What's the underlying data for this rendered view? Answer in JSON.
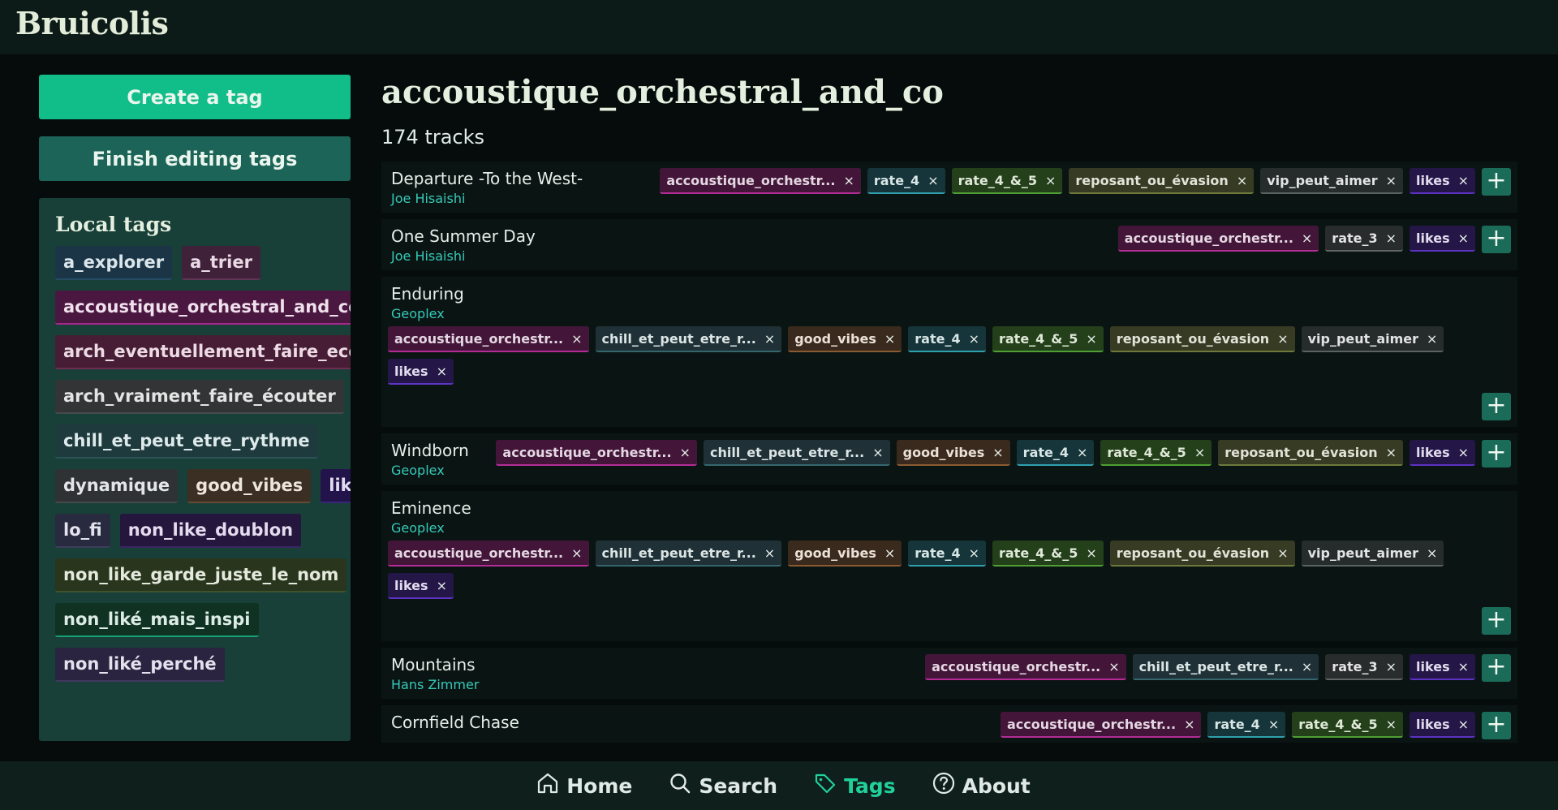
{
  "app": {
    "title": "Bruicolis"
  },
  "sidebar": {
    "create_label": "Create a tag",
    "finish_label": "Finish editing tags",
    "local_title": "Local tags",
    "tags": [
      {
        "label": "a_explorer",
        "theme": "l-explorer"
      },
      {
        "label": "a_trier",
        "theme": "l-trier"
      },
      {
        "label": "accoustique_orchestral_and_co",
        "theme": "l-orch"
      },
      {
        "label": "arch_eventuellement_faire_ecouter",
        "theme": "l-arch1"
      },
      {
        "label": "arch_vraiment_faire_écouter",
        "theme": "l-arch2"
      },
      {
        "label": "chill_et_peut_etre_rythme",
        "theme": "l-chill"
      },
      {
        "label": "dynamique",
        "theme": "l-dyn"
      },
      {
        "label": "good_vibes",
        "theme": "l-good"
      },
      {
        "label": "likes",
        "theme": "l-likes"
      },
      {
        "label": "lo_fi",
        "theme": "l-lofi"
      },
      {
        "label": "non_like_doublon",
        "theme": "l-nonlike"
      },
      {
        "label": "non_like_garde_juste_le_nom",
        "theme": "l-garde"
      },
      {
        "label": "non_liké_mais_inspi",
        "theme": "l-inspi"
      },
      {
        "label": "non_liké_perché",
        "theme": "l-perche"
      }
    ]
  },
  "main": {
    "title": "accoustique_orchestral_and_co",
    "count": "174 tracks",
    "remove_glyph": "×",
    "add_glyph": "+",
    "tracks": [
      {
        "title": "Departure -To the West-",
        "artist": "Joe Hisaishi",
        "wrap": false,
        "tags": [
          {
            "label": "accoustique_orchestr...",
            "theme": "c-orch"
          },
          {
            "label": "rate_4",
            "theme": "c-rate4"
          },
          {
            "label": "rate_4_&_5",
            "theme": "c-rate45"
          },
          {
            "label": "reposant_ou_évasion",
            "theme": "c-repos"
          },
          {
            "label": "vip_peut_aimer",
            "theme": "c-vip"
          },
          {
            "label": "likes",
            "theme": "c-likes"
          }
        ]
      },
      {
        "title": "One Summer Day",
        "artist": "Joe Hisaishi",
        "wrap": false,
        "tags": [
          {
            "label": "accoustique_orchestr...",
            "theme": "c-orch"
          },
          {
            "label": "rate_3",
            "theme": "c-rate3"
          },
          {
            "label": "likes",
            "theme": "c-likes"
          }
        ]
      },
      {
        "title": "Enduring",
        "artist": "Geoplex",
        "wrap": true,
        "tags": [
          {
            "label": "accoustique_orchestr...",
            "theme": "c-orch"
          },
          {
            "label": "chill_et_peut_etre_r...",
            "theme": "c-chill"
          },
          {
            "label": "good_vibes",
            "theme": "c-good"
          },
          {
            "label": "rate_4",
            "theme": "c-rate4"
          },
          {
            "label": "rate_4_&_5",
            "theme": "c-rate45"
          },
          {
            "label": "reposant_ou_évasion",
            "theme": "c-repos"
          },
          {
            "label": "vip_peut_aimer",
            "theme": "c-vip"
          },
          {
            "label": "likes",
            "theme": "c-likes"
          }
        ]
      },
      {
        "title": "Windborn",
        "artist": "Geoplex",
        "wrap": false,
        "tags": [
          {
            "label": "accoustique_orchestr...",
            "theme": "c-orch"
          },
          {
            "label": "chill_et_peut_etre_r...",
            "theme": "c-chill"
          },
          {
            "label": "good_vibes",
            "theme": "c-good"
          },
          {
            "label": "rate_4",
            "theme": "c-rate4"
          },
          {
            "label": "rate_4_&_5",
            "theme": "c-rate45"
          },
          {
            "label": "reposant_ou_évasion",
            "theme": "c-repos"
          },
          {
            "label": "likes",
            "theme": "c-likes"
          }
        ]
      },
      {
        "title": "Eminence",
        "artist": "Geoplex",
        "wrap": true,
        "tags": [
          {
            "label": "accoustique_orchestr...",
            "theme": "c-orch"
          },
          {
            "label": "chill_et_peut_etre_r...",
            "theme": "c-chill"
          },
          {
            "label": "good_vibes",
            "theme": "c-good"
          },
          {
            "label": "rate_4",
            "theme": "c-rate4"
          },
          {
            "label": "rate_4_&_5",
            "theme": "c-rate45"
          },
          {
            "label": "reposant_ou_évasion",
            "theme": "c-repos"
          },
          {
            "label": "vip_peut_aimer",
            "theme": "c-vip"
          },
          {
            "label": "likes",
            "theme": "c-likes"
          }
        ]
      },
      {
        "title": "Mountains",
        "artist": "Hans Zimmer",
        "wrap": false,
        "tags": [
          {
            "label": "accoustique_orchestr...",
            "theme": "c-orch"
          },
          {
            "label": "chill_et_peut_etre_r...",
            "theme": "c-chill"
          },
          {
            "label": "rate_3",
            "theme": "c-rate3"
          },
          {
            "label": "likes",
            "theme": "c-likes"
          }
        ]
      },
      {
        "title": "Cornfield Chase",
        "artist": "",
        "wrap": false,
        "tags": [
          {
            "label": "accoustique_orchestr...",
            "theme": "c-orch"
          },
          {
            "label": "rate_4",
            "theme": "c-rate4"
          },
          {
            "label": "rate_4_&_5",
            "theme": "c-rate45"
          },
          {
            "label": "likes",
            "theme": "c-likes"
          }
        ]
      }
    ]
  },
  "nav": {
    "items": [
      {
        "label": "Home",
        "icon": "home-icon",
        "active": false
      },
      {
        "label": "Search",
        "icon": "search-icon",
        "active": false
      },
      {
        "label": "Tags",
        "icon": "tag-icon",
        "active": true
      },
      {
        "label": "About",
        "icon": "help-circle-icon",
        "active": false
      }
    ]
  }
}
